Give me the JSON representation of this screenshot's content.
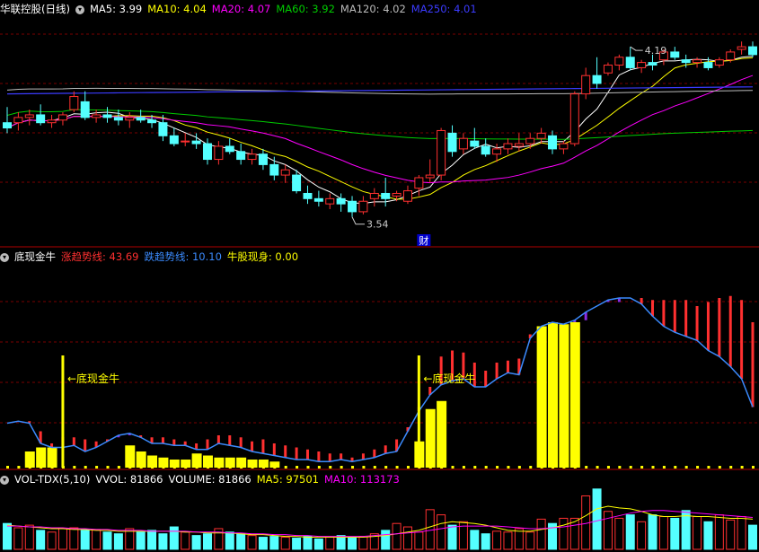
{
  "main": {
    "title": "华联控股(日线)",
    "ma_labels": [
      {
        "text": "MA5: 3.99",
        "color": "#ffffff"
      },
      {
        "text": "MA10: 4.04",
        "color": "#ffff00"
      },
      {
        "text": "MA20: 4.07",
        "color": "#ff00ff"
      },
      {
        "text": "MA60: 3.92",
        "color": "#00cc00"
      },
      {
        "text": "MA120: 4.02",
        "color": "#bbbbbb"
      },
      {
        "text": "MA250: 4.01",
        "color": "#3b3bff"
      }
    ],
    "high_label": "4.19",
    "low_label": "3.54",
    "marker": "财"
  },
  "indicator": {
    "title": "底现金牛",
    "labels": [
      {
        "text": "涨趋势线: 43.69",
        "color": "#ff3030"
      },
      {
        "text": "跌趋势线: 10.10",
        "color": "#3b8bff"
      },
      {
        "text": "牛股现身: 0.00",
        "color": "#ffff00"
      }
    ],
    "signal_text": "←底现金牛"
  },
  "volume": {
    "title": "VOL-TDX(5,10)",
    "labels": [
      {
        "text": "VVOL: 81866",
        "color": "#ffffff"
      },
      {
        "text": "VOLUME: 81866",
        "color": "#ffffff"
      },
      {
        "text": "MA5: 97501",
        "color": "#ffff00"
      },
      {
        "text": "MA10: 113173",
        "color": "#ff00ff"
      }
    ]
  },
  "colors": {
    "up": "#ff3030",
    "down": "#54ffff",
    "grid": "#7a0000",
    "bg": "#000000"
  },
  "chart_data": {
    "type": "candlestick",
    "price_ylim": [
      3.45,
      4.3
    ],
    "ohlc": [
      [
        3.9,
        3.96,
        3.86,
        3.88
      ],
      [
        3.9,
        3.94,
        3.87,
        3.92
      ],
      [
        3.92,
        3.95,
        3.89,
        3.93
      ],
      [
        3.93,
        3.97,
        3.89,
        3.9
      ],
      [
        3.9,
        3.93,
        3.88,
        3.91
      ],
      [
        3.91,
        3.94,
        3.89,
        3.93
      ],
      [
        3.95,
        4.02,
        3.94,
        4.0
      ],
      [
        3.98,
        4.02,
        3.91,
        3.92
      ],
      [
        3.92,
        3.95,
        3.9,
        3.93
      ],
      [
        3.93,
        3.96,
        3.9,
        3.92
      ],
      [
        3.92,
        3.95,
        3.89,
        3.91
      ],
      [
        3.91,
        3.94,
        3.88,
        3.92
      ],
      [
        3.92,
        3.95,
        3.9,
        3.91
      ],
      [
        3.91,
        3.93,
        3.88,
        3.9
      ],
      [
        3.9,
        3.93,
        3.83,
        3.85
      ],
      [
        3.85,
        3.88,
        3.81,
        3.82
      ],
      [
        3.83,
        3.86,
        3.81,
        3.83
      ],
      [
        3.83,
        3.86,
        3.8,
        3.82
      ],
      [
        3.82,
        3.84,
        3.74,
        3.76
      ],
      [
        3.76,
        3.83,
        3.74,
        3.81
      ],
      [
        3.81,
        3.84,
        3.78,
        3.79
      ],
      [
        3.79,
        3.82,
        3.74,
        3.76
      ],
      [
        3.76,
        3.8,
        3.74,
        3.78
      ],
      [
        3.78,
        3.8,
        3.72,
        3.74
      ],
      [
        3.74,
        3.77,
        3.68,
        3.7
      ],
      [
        3.7,
        3.74,
        3.67,
        3.72
      ],
      [
        3.7,
        3.72,
        3.63,
        3.64
      ],
      [
        3.63,
        3.66,
        3.59,
        3.61
      ],
      [
        3.61,
        3.64,
        3.58,
        3.6
      ],
      [
        3.59,
        3.63,
        3.57,
        3.61
      ],
      [
        3.61,
        3.63,
        3.56,
        3.59
      ],
      [
        3.6,
        3.62,
        3.54,
        3.56
      ],
      [
        3.56,
        3.62,
        3.55,
        3.6
      ],
      [
        3.61,
        3.65,
        3.58,
        3.63
      ],
      [
        3.63,
        3.69,
        3.58,
        3.61
      ],
      [
        3.62,
        3.64,
        3.6,
        3.63
      ],
      [
        3.6,
        3.66,
        3.59,
        3.64
      ],
      [
        3.65,
        3.7,
        3.62,
        3.69
      ],
      [
        3.69,
        3.76,
        3.67,
        3.7
      ],
      [
        3.7,
        3.88,
        3.68,
        3.87
      ],
      [
        3.86,
        3.89,
        3.77,
        3.79
      ],
      [
        3.8,
        3.86,
        3.78,
        3.84
      ],
      [
        3.83,
        3.88,
        3.8,
        3.81
      ],
      [
        3.81,
        3.84,
        3.77,
        3.78
      ],
      [
        3.78,
        3.82,
        3.75,
        3.8
      ],
      [
        3.8,
        3.84,
        3.78,
        3.82
      ],
      [
        3.81,
        3.86,
        3.79,
        3.82
      ],
      [
        3.82,
        3.86,
        3.8,
        3.84
      ],
      [
        3.84,
        3.88,
        3.82,
        3.86
      ],
      [
        3.85,
        3.87,
        3.78,
        3.8
      ],
      [
        3.8,
        3.83,
        3.78,
        3.82
      ],
      [
        3.82,
        4.02,
        3.81,
        4.01
      ],
      [
        4.01,
        4.11,
        3.99,
        4.08
      ],
      [
        4.08,
        4.15,
        4.03,
        4.05
      ],
      [
        4.09,
        4.13,
        4.08,
        4.12
      ],
      [
        4.12,
        4.16,
        4.1,
        4.15
      ],
      [
        4.15,
        4.19,
        4.1,
        4.11
      ],
      [
        4.11,
        4.14,
        4.09,
        4.13
      ],
      [
        4.13,
        4.16,
        4.1,
        4.12
      ],
      [
        4.14,
        4.18,
        4.12,
        4.17
      ],
      [
        4.17,
        4.19,
        4.14,
        4.15
      ],
      [
        4.14,
        4.16,
        4.11,
        4.13
      ],
      [
        4.13,
        4.15,
        4.11,
        4.14
      ],
      [
        4.13,
        4.15,
        4.1,
        4.11
      ],
      [
        4.12,
        4.15,
        4.11,
        4.14
      ],
      [
        4.14,
        4.18,
        4.13,
        4.17
      ],
      [
        4.18,
        4.21,
        4.16,
        4.19
      ],
      [
        4.19,
        4.21,
        4.15,
        4.16
      ]
    ],
    "indicator_ylim": [
      0,
      100
    ],
    "rise_line": [
      22,
      23,
      23,
      18,
      12,
      15,
      15,
      14,
      13,
      14,
      15,
      16,
      16,
      15,
      15,
      14,
      13,
      12,
      14,
      16,
      16,
      15,
      13,
      14,
      12,
      11,
      10,
      9,
      8,
      7,
      7,
      5,
      7,
      9,
      11,
      14,
      20,
      30,
      40,
      55,
      58,
      57,
      52,
      48,
      52,
      53,
      54,
      66,
      70,
      72,
      70,
      72,
      73,
      80,
      82,
      82,
      84,
      84,
      83,
      83,
      83,
      83,
      80,
      82,
      84,
      85,
      83,
      72
    ],
    "fall_line": [
      22,
      23,
      22,
      12,
      10,
      10,
      11,
      8,
      10,
      13,
      16,
      17,
      15,
      12,
      12,
      11,
      11,
      9,
      9,
      12,
      11,
      10,
      8,
      7,
      6,
      5,
      4,
      4,
      3,
      3,
      4,
      3,
      4,
      5,
      7,
      8,
      18,
      28,
      36,
      41,
      43,
      44,
      40,
      40,
      44,
      47,
      46,
      64,
      70,
      72,
      71,
      73,
      77,
      80,
      83,
      84,
      84,
      81,
      75,
      70,
      67,
      65,
      63,
      58,
      55,
      50,
      44,
      30
    ],
    "bull_bars": [
      {
        "i": 2,
        "v": 8
      },
      {
        "i": 3,
        "v": 10
      },
      {
        "i": 4,
        "v": 10
      },
      {
        "i": 11,
        "v": 11
      },
      {
        "i": 12,
        "v": 8
      },
      {
        "i": 13,
        "v": 6
      },
      {
        "i": 14,
        "v": 5
      },
      {
        "i": 15,
        "v": 4
      },
      {
        "i": 16,
        "v": 4
      },
      {
        "i": 17,
        "v": 7
      },
      {
        "i": 18,
        "v": 6
      },
      {
        "i": 19,
        "v": 5
      },
      {
        "i": 20,
        "v": 5
      },
      {
        "i": 21,
        "v": 5
      },
      {
        "i": 22,
        "v": 4
      },
      {
        "i": 23,
        "v": 4
      },
      {
        "i": 24,
        "v": 3
      },
      {
        "i": 37,
        "v": 13
      },
      {
        "i": 38,
        "v": 29
      },
      {
        "i": 39,
        "v": 33
      },
      {
        "i": 48,
        "v": 70
      },
      {
        "i": 49,
        "v": 72
      },
      {
        "i": 50,
        "v": 71
      },
      {
        "i": 51,
        "v": 72
      }
    ],
    "signal_bars": [
      5,
      37
    ],
    "volume": [
      30,
      25,
      28,
      22,
      20,
      24,
      25,
      22,
      23,
      20,
      18,
      24,
      20,
      22,
      18,
      26,
      20,
      16,
      18,
      24,
      20,
      18,
      16,
      14,
      15,
      14,
      13,
      15,
      12,
      14,
      16,
      13,
      15,
      18,
      22,
      30,
      26,
      20,
      46,
      40,
      28,
      32,
      22,
      18,
      21,
      20,
      24,
      20,
      35,
      30,
      36,
      36,
      62,
      70,
      44,
      36,
      40,
      32,
      40,
      38,
      36,
      45,
      38,
      32,
      40,
      34,
      38,
      28
    ],
    "volume_ma5": [
      28,
      27,
      26,
      25,
      24,
      24,
      23,
      23,
      22,
      22,
      21,
      21,
      21,
      21,
      21,
      21,
      20,
      20,
      19,
      19,
      19,
      18,
      17,
      17,
      16,
      15,
      15,
      14,
      14,
      14,
      14,
      14,
      14,
      15,
      16,
      18,
      20,
      22,
      26,
      30,
      32,
      31,
      30,
      28,
      25,
      22,
      21,
      21,
      23,
      25,
      28,
      32,
      39,
      47,
      50,
      48,
      47,
      44,
      40,
      38,
      38,
      39,
      38,
      38,
      37,
      36,
      36,
      35
    ],
    "volume_ma10": [
      27,
      27,
      26,
      26,
      25,
      25,
      24,
      24,
      23,
      23,
      22,
      22,
      22,
      21,
      21,
      21,
      21,
      20,
      20,
      20,
      19,
      19,
      18,
      18,
      17,
      17,
      16,
      16,
      15,
      15,
      15,
      15,
      15,
      16,
      17,
      18,
      19,
      20,
      22,
      24,
      26,
      27,
      27,
      27,
      27,
      26,
      25,
      24,
      24,
      25,
      26,
      28,
      30,
      33,
      36,
      39,
      42,
      44,
      45,
      45,
      44,
      43,
      42,
      41,
      40,
      39,
      38,
      37
    ]
  }
}
